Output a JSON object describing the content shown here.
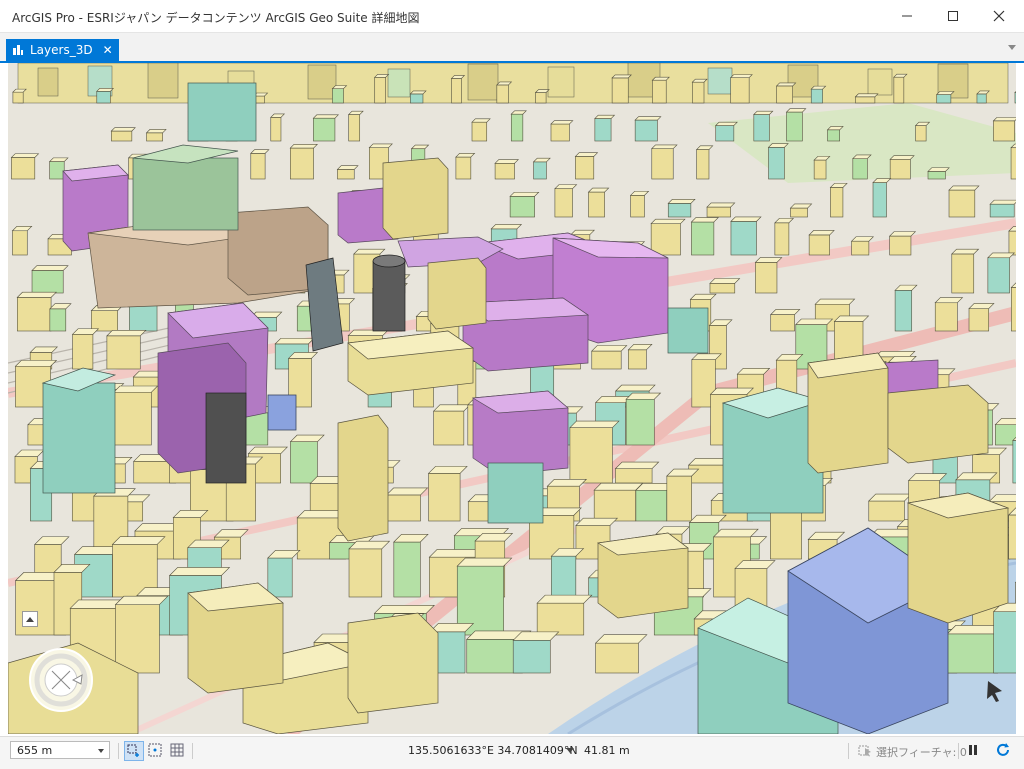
{
  "window": {
    "title": "ArcGIS Pro - ESRIジャパン データコンテンツ ArcGIS Geo Suite 詳細地図",
    "minimize_icon": "minimize-icon",
    "maximize_icon": "maximize-icon",
    "close_icon": "close-icon"
  },
  "tabs": [
    {
      "label": "Layers_3D",
      "active": true,
      "icon": "scene-map-icon",
      "close_icon": "close-icon"
    }
  ],
  "map": {
    "view_type": "3D scene",
    "navigator_icon": "navigator-icon",
    "collapse_icon": "chevron-up-icon"
  },
  "status": {
    "scale": "655 m",
    "coordinates": "135.5061633°E 34.7081409°N",
    "elevation": "41.81 m",
    "selected_features": "選択フィーチャ: 0"
  },
  "colors": {
    "accent": "#0078d7",
    "building_yellow": "#ecdf9a",
    "building_purple": "#c784d6",
    "building_teal": "#9fd9c8",
    "building_blue": "#8fa6e0",
    "building_green": "#b4e0a5",
    "building_tan": "#dcc3a6"
  }
}
